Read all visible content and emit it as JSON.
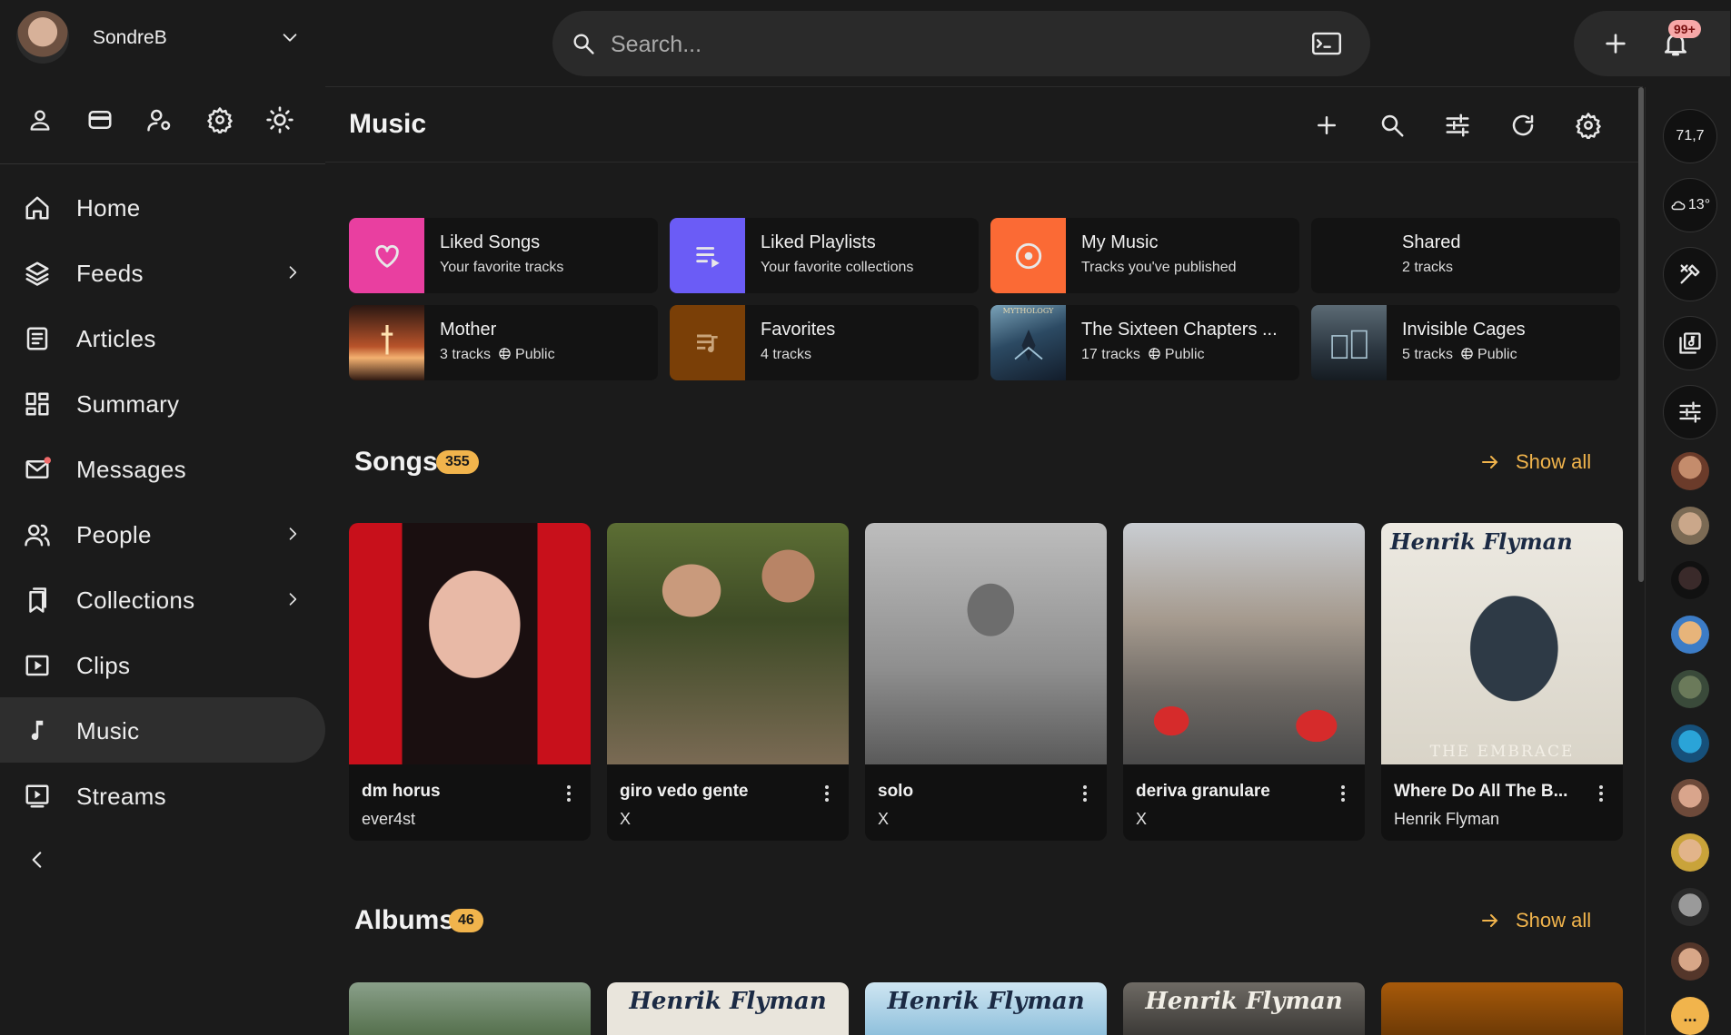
{
  "user": {
    "name": "SondreB"
  },
  "nav": {
    "items": [
      {
        "label": "Home"
      },
      {
        "label": "Feeds"
      },
      {
        "label": "Articles"
      },
      {
        "label": "Summary"
      },
      {
        "label": "Messages"
      },
      {
        "label": "People"
      },
      {
        "label": "Collections"
      },
      {
        "label": "Clips"
      },
      {
        "label": "Music"
      },
      {
        "label": "Streams"
      }
    ],
    "active": "Music"
  },
  "search": {
    "placeholder": "Search..."
  },
  "notifications": {
    "badge": "99+"
  },
  "page": {
    "title": "Music"
  },
  "tiles": [
    {
      "title": "Liked Songs",
      "subtitle": "Your favorite tracks",
      "color": "#e93fa0"
    },
    {
      "title": "Liked Playlists",
      "subtitle": "Your favorite collections",
      "color": "#6b5cf6"
    },
    {
      "title": "My Music",
      "subtitle": "Tracks you've published",
      "color": "#fb6a35"
    },
    {
      "title": "Shared",
      "subtitle": "2 tracks",
      "color": "#131313"
    },
    {
      "title": "Mother",
      "tracks": "3 tracks",
      "visibility": "Public"
    },
    {
      "title": "Favorites",
      "subtitle": "4 tracks",
      "color": "#7a3f07"
    },
    {
      "title": "The Sixteen Chapters ...",
      "tracks": "17 tracks",
      "visibility": "Public"
    },
    {
      "title": "Invisible Cages",
      "tracks": "5 tracks",
      "visibility": "Public"
    }
  ],
  "songs": {
    "title": "Songs",
    "count": "355",
    "show_all": "Show all",
    "items": [
      {
        "title": "dm horus",
        "artist": "ever4st"
      },
      {
        "title": "giro vedo gente",
        "artist": "X"
      },
      {
        "title": "solo",
        "artist": "X"
      },
      {
        "title": "deriva granulare",
        "artist": "X"
      },
      {
        "title": "Where Do All The B...",
        "artist": "Henrik Flyman"
      }
    ]
  },
  "albums": {
    "title": "Albums",
    "count": "46",
    "show_all": "Show all",
    "cover_text": "Henrik Flyman"
  },
  "cover_texts": {
    "fifth_song": "THE EMBRACE",
    "fifth_song_logo": "Henrik Flyman",
    "mythology": "MYTHOLOGY"
  },
  "rail": {
    "stat": "71,7",
    "weather": "13°",
    "more": "..."
  },
  "accent": "#f1b44c"
}
